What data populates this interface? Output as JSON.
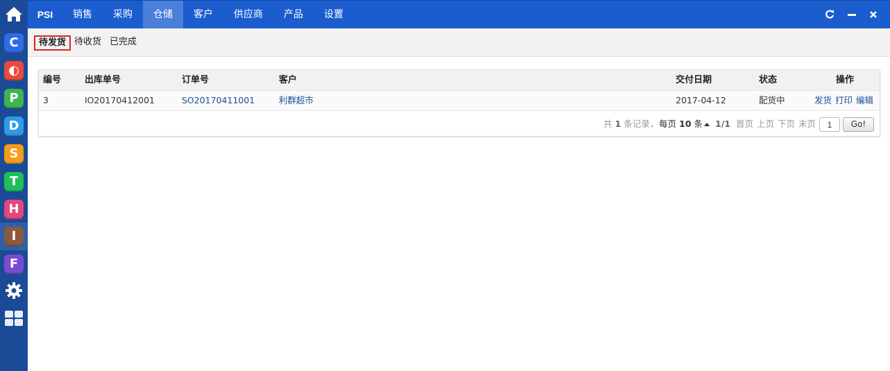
{
  "dock": {
    "apps": [
      {
        "letter": "C",
        "color": "#2f6be8",
        "icon": "app-c-icon"
      },
      {
        "letter": "◐",
        "color": "#e84b3c",
        "icon": "app-o-icon"
      },
      {
        "letter": "P",
        "color": "#3fb34f",
        "icon": "app-p-icon"
      },
      {
        "letter": "D",
        "color": "#2f9be8",
        "icon": "app-d-icon"
      },
      {
        "letter": "S",
        "color": "#f59c1a",
        "icon": "app-s-icon"
      },
      {
        "letter": "T",
        "color": "#1fbf5a",
        "icon": "app-t-icon"
      },
      {
        "letter": "H",
        "color": "#e8457a",
        "icon": "app-h-icon"
      },
      {
        "letter": "I",
        "color": "#8a5a3c",
        "icon": "app-i-icon"
      },
      {
        "letter": "F",
        "color": "#7a4bd0",
        "icon": "app-f-icon"
      }
    ]
  },
  "nav": {
    "brand": "PSI",
    "items": [
      "销售",
      "采购",
      "仓储",
      "客户",
      "供应商",
      "产品",
      "设置"
    ],
    "active": "仓储"
  },
  "subtabs": [
    "待发货",
    "待收货",
    "已完成"
  ],
  "subtab_active": "待发货",
  "table": {
    "headers": [
      "编号",
      "出库单号",
      "订单号",
      "客户",
      "交付日期",
      "状态",
      "操作"
    ],
    "rows": [
      {
        "id": "3",
        "outbound_no": "IO20170412001",
        "order_no": "SO20170411001",
        "customer": "利群超市",
        "delivery_date": "2017-04-12",
        "status": "配货中",
        "actions": [
          "发货",
          "打印",
          "编辑"
        ]
      }
    ]
  },
  "pager": {
    "total_prefix": "共",
    "total": "1",
    "total_suffix": "条记录，",
    "per_page_prefix": "每页",
    "per_page": "10",
    "per_page_suffix": "条",
    "page_info": "1/1",
    "first": "首页",
    "prev": "上页",
    "next": "下页",
    "last": "末页",
    "input_value": "1",
    "go": "Go!"
  },
  "colors": {
    "topbar": "#1b5dcf",
    "dock": "#1b4b96",
    "link": "#1d4f9c",
    "active_tab_border": "#e02424"
  }
}
